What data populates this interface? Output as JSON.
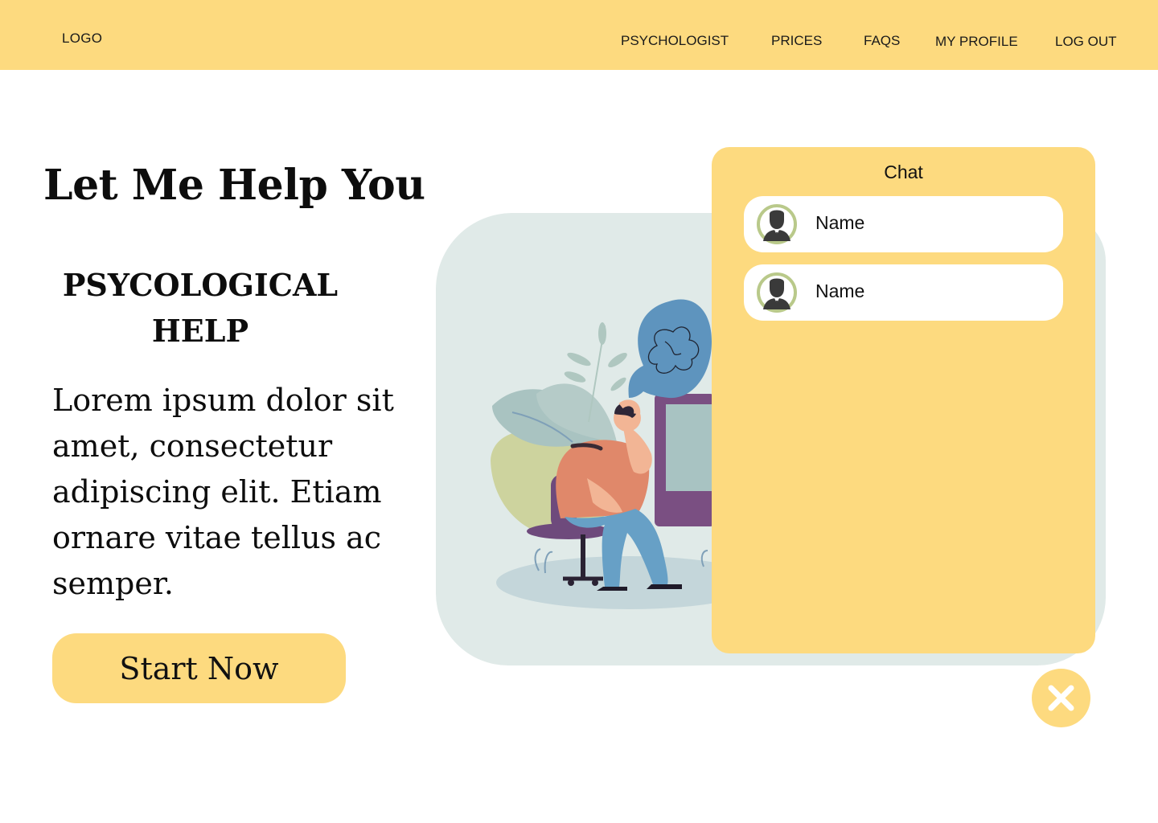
{
  "header": {
    "logo": "LOGO",
    "nav": [
      "PSYCHOLOGIST",
      "PRICES",
      "FAQS",
      "MY PROFILE",
      "LOG OUT"
    ]
  },
  "hero": {
    "title": "Let Me Help You",
    "subtitle": "PSYCOLOGICAL HELP",
    "body": "Lorem ipsum dolor sit amet, consectetur adipiscing elit. Etiam ornare vitae tellus ac semper.",
    "cta_label": "Start Now"
  },
  "chat": {
    "title": "Chat",
    "contacts": [
      {
        "name": "Name",
        "avatar_icon": "user-avatar-icon"
      },
      {
        "name": "Name",
        "avatar_icon": "user-avatar-icon"
      }
    ],
    "close_icon": "close-icon"
  },
  "colors": {
    "accent": "#FDDA7F",
    "illustration_bg": "#E0EAE8",
    "avatar_ring": "#B9C98A"
  }
}
